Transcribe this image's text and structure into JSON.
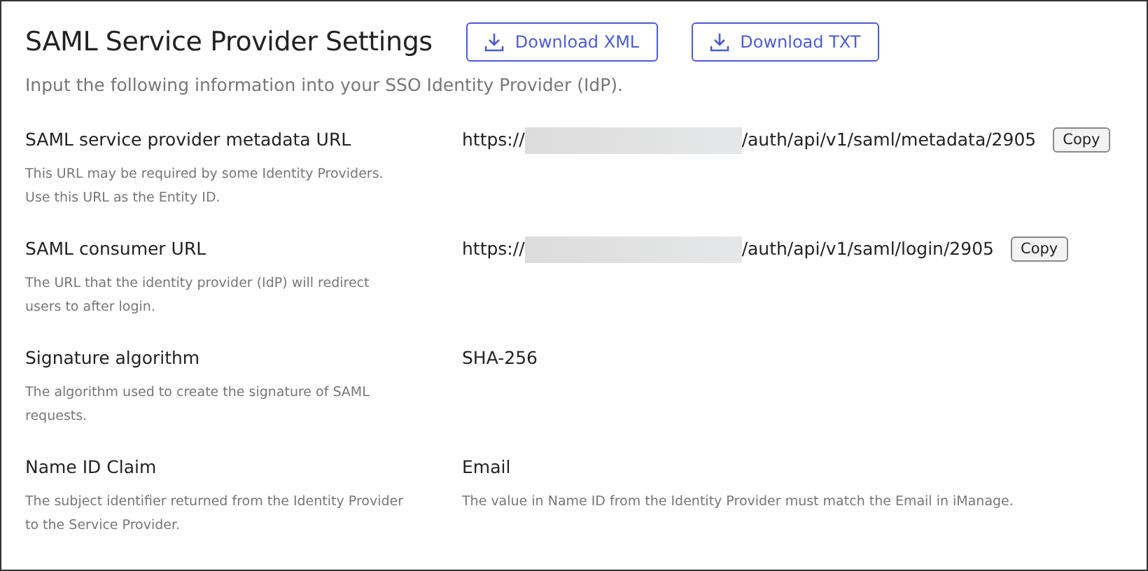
{
  "title": "SAML Service Provider Settings",
  "buttons": [
    {
      "label": "Download XML"
    },
    {
      "label": "Download TXT"
    }
  ],
  "subtitle": "Input the following information into your SSO Identity Provider (IdP).",
  "fields": [
    {
      "kind": "url",
      "label": "SAML service provider metadata URL",
      "description": [
        "This URL may be required by some Identity Providers.",
        "Use this URL as the Entity ID."
      ],
      "value_prefix": "https://",
      "value_suffix": "/auth/api/v1/saml/metadata/2905",
      "action": "Copy"
    },
    {
      "kind": "url",
      "label": "SAML consumer URL",
      "description": [
        "The URL that the identity provider (IdP) will redirect",
        "users to after login."
      ],
      "value_prefix": "https://",
      "value_suffix": "/auth/api/v1/saml/login/2905",
      "action": "Copy"
    },
    {
      "kind": "text",
      "label": "Signature algorithm",
      "description": [
        "The algorithm used to create the signature of SAML",
        "requests."
      ],
      "value": "SHA-256"
    },
    {
      "kind": "text",
      "label": "Name ID Claim",
      "description": [
        "The subject identifier returned from the Identity Provider",
        "to the Service Provider."
      ],
      "value": "Email",
      "note": "The value in Name ID from the Identity Provider must match the Email in iManage."
    }
  ]
}
